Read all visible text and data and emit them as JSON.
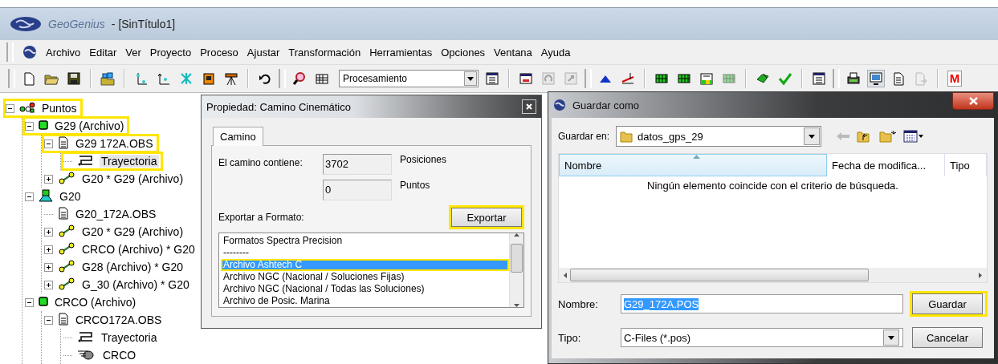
{
  "window": {
    "app_name": "GeoGenius",
    "document": "- [SinTítulo1]"
  },
  "menu": [
    "Archivo",
    "Editar",
    "Ver",
    "Proyecto",
    "Proceso",
    "Ajustar",
    "Transformación",
    "Herramientas",
    "Opciones",
    "Ventana",
    "Ayuda"
  ],
  "toolbar": [
    {
      "kind": "grip"
    },
    {
      "kind": "new",
      "disabled": false,
      "pressed": false
    },
    {
      "kind": "open",
      "disabled": false,
      "pressed": false
    },
    {
      "kind": "save",
      "disabled": false,
      "pressed": false
    },
    {
      "kind": "sep"
    },
    {
      "kind": "import",
      "disabled": false,
      "pressed": false
    },
    {
      "kind": "sep"
    },
    {
      "kind": "axes",
      "disabled": false,
      "pressed": false
    },
    {
      "kind": "axes2",
      "disabled": false,
      "pressed": false
    },
    {
      "kind": "star",
      "disabled": false,
      "pressed": false
    },
    {
      "kind": "receiver",
      "disabled": false,
      "pressed": false
    },
    {
      "kind": "tripod",
      "disabled": false,
      "pressed": false
    },
    {
      "kind": "sep"
    },
    {
      "kind": "undo",
      "disabled": false,
      "pressed": false
    },
    {
      "kind": "grip"
    },
    {
      "kind": "zoom",
      "disabled": false,
      "pressed": false
    },
    {
      "kind": "grid",
      "disabled": false,
      "pressed": false
    },
    {
      "kind": "combo",
      "value": "Procesamiento"
    },
    {
      "kind": "panel",
      "disabled": false,
      "pressed": false
    },
    {
      "kind": "sep"
    },
    {
      "kind": "window",
      "disabled": false,
      "pressed": false
    },
    {
      "kind": "refresh",
      "disabled": true,
      "pressed": false
    },
    {
      "kind": "export",
      "disabled": true,
      "pressed": false
    },
    {
      "kind": "grip"
    },
    {
      "kind": "triangle",
      "disabled": false,
      "pressed": false
    },
    {
      "kind": "measure",
      "disabled": false,
      "pressed": false
    },
    {
      "kind": "sep"
    },
    {
      "kind": "network",
      "disabled": false,
      "pressed": false
    },
    {
      "kind": "network",
      "disabled": false,
      "pressed": false
    },
    {
      "kind": "report",
      "disabled": false,
      "pressed": false
    },
    {
      "kind": "network",
      "disabled": true,
      "pressed": false
    },
    {
      "kind": "sep"
    },
    {
      "kind": "checkarrow",
      "disabled": false,
      "pressed": false
    },
    {
      "kind": "check",
      "disabled": false,
      "pressed": false
    },
    {
      "kind": "sep"
    },
    {
      "kind": "panel",
      "disabled": false,
      "pressed": false
    },
    {
      "kind": "grip"
    },
    {
      "kind": "printer",
      "disabled": false,
      "pressed": false
    },
    {
      "kind": "monitor",
      "disabled": false,
      "pressed": true
    },
    {
      "kind": "doc",
      "disabled": false,
      "pressed": false
    },
    {
      "kind": "docarrow",
      "disabled": true,
      "pressed": false
    },
    {
      "kind": "sep"
    },
    {
      "kind": "letter",
      "label": "M",
      "disabled": false,
      "pressed": false
    }
  ],
  "tree": [
    {
      "label": "Puntos",
      "kind": "points",
      "expanded": true,
      "selected": false,
      "highlighted": true,
      "children": [
        {
          "label": "G29 (Archivo)",
          "kind": "point",
          "expanded": true,
          "selected": false,
          "highlighted": true,
          "children": [
            {
              "label": "G29 172A.OBS",
              "kind": "doc",
              "expanded": true,
              "selected": false,
              "highlighted": true,
              "children": [
                {
                  "label": "Trayectoria",
                  "kind": "path",
                  "selected": true,
                  "highlighted": true
                }
              ]
            },
            {
              "label": "G20 * G29 (Archivo)",
              "kind": "baseline",
              "expanded": false,
              "selected": false,
              "highlighted": false
            }
          ]
        },
        {
          "label": "G20",
          "kind": "base",
          "expanded": true,
          "selected": false,
          "highlighted": false,
          "children": [
            {
              "label": "G20_172A.OBS",
              "kind": "doc",
              "selected": false,
              "highlighted": false
            },
            {
              "label": "G20 * G29 (Archivo)",
              "kind": "baseline",
              "expanded": false,
              "selected": false,
              "highlighted": false
            },
            {
              "label": "CRCO (Archivo) * G20",
              "kind": "baseline",
              "expanded": false,
              "selected": false,
              "highlighted": false
            },
            {
              "label": "G28 (Archivo) * G20",
              "kind": "baseline",
              "expanded": false,
              "selected": false,
              "highlighted": false
            },
            {
              "label": "G_30 (Archivo) * G20",
              "kind": "baseline",
              "expanded": false,
              "selected": false,
              "highlighted": false
            }
          ]
        },
        {
          "label": "CRCO (Archivo)",
          "kind": "point",
          "expanded": true,
          "selected": false,
          "highlighted": false,
          "children": [
            {
              "label": "CRCO172A.OBS",
              "kind": "doc",
              "expanded": true,
              "selected": false,
              "highlighted": false,
              "children": [
                {
                  "label": "Trayectoria",
                  "kind": "path",
                  "selected": false,
                  "highlighted": false
                },
                {
                  "label": "CRCO",
                  "kind": "antenna",
                  "selected": false,
                  "highlighted": false
                }
              ]
            }
          ]
        }
      ]
    }
  ],
  "property_dialog": {
    "title": "Propiedad: Camino Cinemático",
    "tabs": [
      {
        "label": "Camino",
        "selected": true
      }
    ],
    "path_label": "El camino contiene:",
    "counts": [
      {
        "value": "3702",
        "unit": "Posiciones"
      },
      {
        "value": "0",
        "unit": "Puntos"
      }
    ],
    "export_label": "Exportar a Formato:",
    "export_button": {
      "label": "Exportar",
      "highlighted": true
    },
    "formats": [
      {
        "label": "Formatos Spectra Precision",
        "selected": false,
        "highlighted": false
      },
      {
        "label": "--------",
        "selected": false,
        "highlighted": false
      },
      {
        "label": "Archivo Ashtech C",
        "selected": true,
        "highlighted": true
      },
      {
        "label": "Archivo NGC (Nacional / Soluciones Fijas)",
        "selected": false,
        "highlighted": false
      },
      {
        "label": "Archivo NGC (Nacional / Todas las Soluciones)",
        "selected": false,
        "highlighted": false
      },
      {
        "label": "Archivo de Posic. Marina",
        "selected": false,
        "highlighted": false
      }
    ]
  },
  "save_dialog": {
    "title": "Guardar como",
    "save_in_label": "Guardar en:",
    "folder": "datos_gps_29",
    "columns": [
      {
        "label": "Nombre",
        "sorted": true
      },
      {
        "label": "Fecha de modifica...",
        "sorted": false
      },
      {
        "label": "Tipo",
        "sorted": false
      }
    ],
    "empty_message": "Ningún elemento coincide con el criterio de búsqueda.",
    "name_label": "Nombre:",
    "name_value": "G29_172A.POS",
    "name_selected": true,
    "type_label": "Tipo:",
    "type_value": "C-Files (*.pos)",
    "buttons": [
      {
        "label": "Guardar",
        "highlighted": true
      },
      {
        "label": "Cancelar",
        "highlighted": false
      }
    ]
  }
}
